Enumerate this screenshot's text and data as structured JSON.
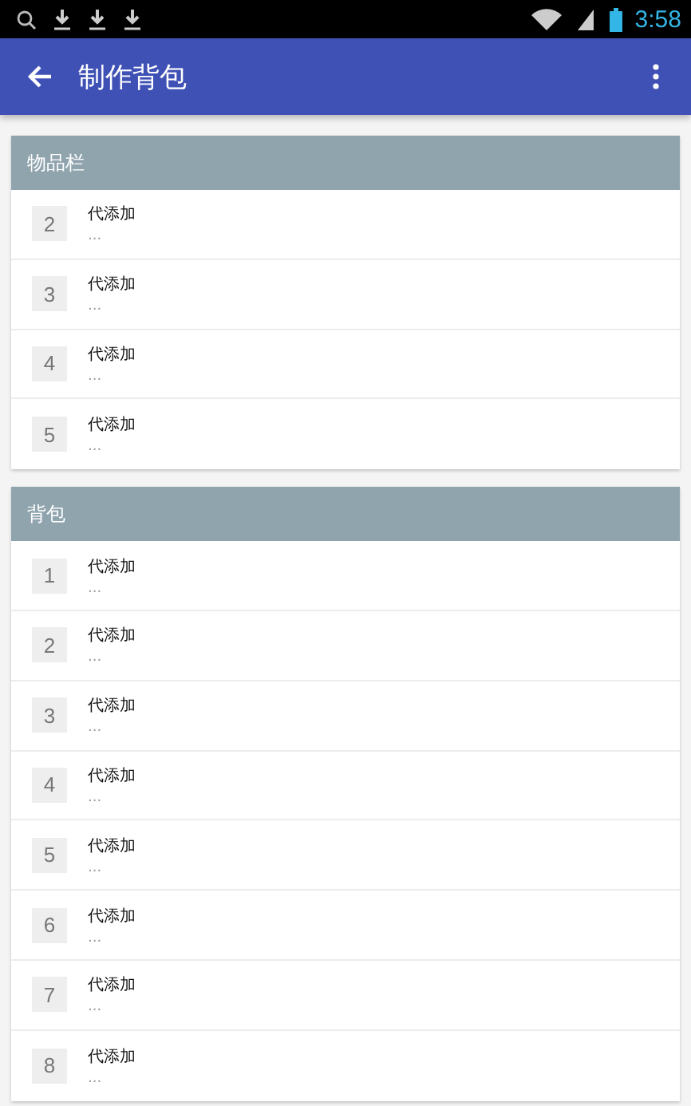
{
  "status_bar": {
    "time": "3:58"
  },
  "app_bar": {
    "title": "制作背包"
  },
  "sections": [
    {
      "title": "物品栏",
      "items": [
        {
          "number": "2",
          "name": "代添加",
          "detail": "..."
        },
        {
          "number": "3",
          "name": "代添加",
          "detail": "..."
        },
        {
          "number": "4",
          "name": "代添加",
          "detail": "..."
        },
        {
          "number": "5",
          "name": "代添加",
          "detail": "..."
        }
      ]
    },
    {
      "title": "背包",
      "items": [
        {
          "number": "1",
          "name": "代添加",
          "detail": "..."
        },
        {
          "number": "2",
          "name": "代添加",
          "detail": "..."
        },
        {
          "number": "3",
          "name": "代添加",
          "detail": "..."
        },
        {
          "number": "4",
          "name": "代添加",
          "detail": "..."
        },
        {
          "number": "5",
          "name": "代添加",
          "detail": "..."
        },
        {
          "number": "6",
          "name": "代添加",
          "detail": "..."
        },
        {
          "number": "7",
          "name": "代添加",
          "detail": "..."
        },
        {
          "number": "8",
          "name": "代添加",
          "detail": "..."
        }
      ]
    }
  ]
}
